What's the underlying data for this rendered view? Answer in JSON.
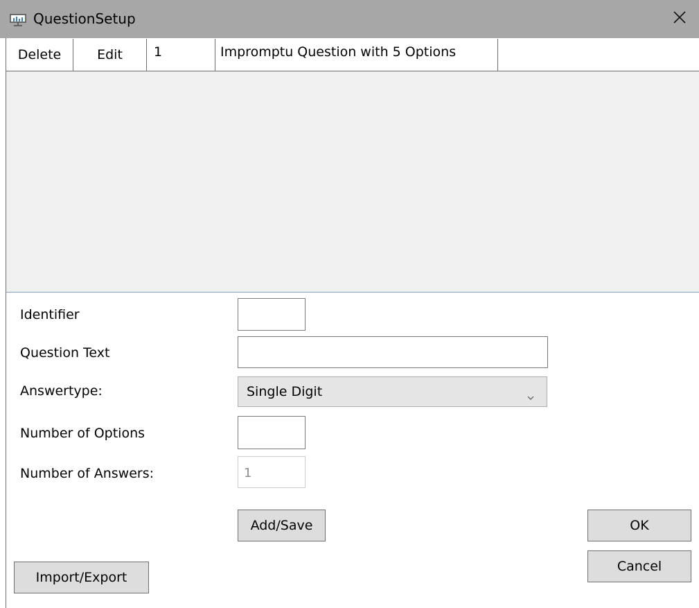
{
  "window": {
    "title": "QuestionSetup",
    "icon": "presentation-board-icon",
    "close_icon": "close-icon"
  },
  "grid": {
    "rows": [
      {
        "delete_label": "Delete",
        "edit_label": "Edit",
        "id": "1",
        "name": "Impromptu Question with 5 Options"
      }
    ],
    "empty_area_color": "#f0f0f0"
  },
  "form": {
    "identifier": {
      "label": "Identifier",
      "value": ""
    },
    "question_text": {
      "label": "Question Text",
      "value": ""
    },
    "answer_type": {
      "label": "Answertype:",
      "selected": "Single Digit"
    },
    "number_of_options": {
      "label": "Number of Options",
      "value": ""
    },
    "number_of_answers": {
      "label": "Number of Answers:",
      "value": "1",
      "disabled": true
    }
  },
  "buttons": {
    "add_save": "Add/Save",
    "ok": "OK",
    "cancel": "Cancel",
    "import_export": "Import/Export"
  },
  "colors": {
    "titlebar": "#a7a7a7",
    "button_bg": "#dddddd",
    "combo_bg": "#e5e5e5",
    "grid_separator": "#84a0c6"
  }
}
